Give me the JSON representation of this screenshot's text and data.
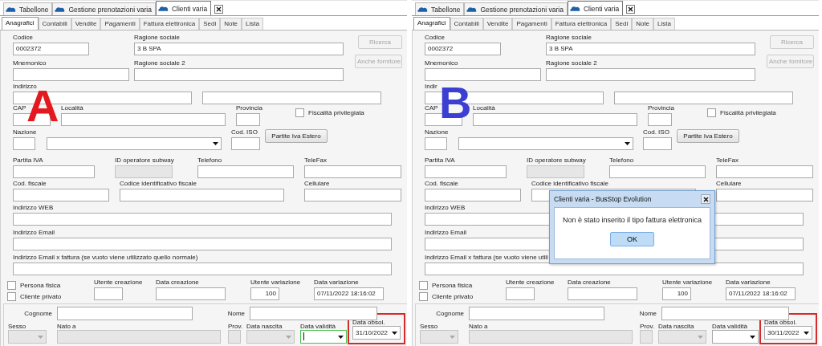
{
  "panels": [
    {
      "marker": {
        "text": "A",
        "color": "#e3191f"
      },
      "doc_tabs": [
        {
          "label": "Tabellone",
          "selected": false
        },
        {
          "label": "Gestione prenotazioni varia",
          "selected": false
        },
        {
          "label": "Clienti varia",
          "selected": true
        }
      ],
      "sub_tabs": [
        {
          "label": "Anagrafici",
          "selected": true
        },
        {
          "label": "Contabili",
          "selected": false
        },
        {
          "label": "Vendite",
          "selected": false
        },
        {
          "label": "Pagamenti",
          "selected": false
        },
        {
          "label": "Fattura elettronica",
          "selected": false
        },
        {
          "label": "Sedi",
          "selected": false
        },
        {
          "label": "Note",
          "selected": false
        },
        {
          "label": "Lista",
          "selected": false
        }
      ],
      "rows": [
        {
          "items": [
            {
              "kind": "text",
              "label": "Codice",
              "value": "0002372",
              "disabled": false
            },
            {
              "kind": "text",
              "label": "Ragione sociale",
              "value": "3 B SPA",
              "disabled": false
            },
            {
              "kind": "button",
              "label": "Ricerca",
              "disabled": true
            }
          ]
        },
        {
          "items": [
            {
              "kind": "text",
              "label": "Mnemonico",
              "disabled": false
            },
            {
              "kind": "text",
              "label": "Ragione sociale 2",
              "disabled": false
            },
            {
              "kind": "button",
              "label": "Anche fornitore",
              "disabled": true
            }
          ]
        },
        {
          "items": [
            {
              "kind": "text",
              "label": "Indirizzo",
              "disabled": false
            },
            {
              "kind": "text",
              "disabled": false
            }
          ]
        },
        {
          "items": [
            {
              "kind": "text",
              "label": "CAP",
              "disabled": false
            },
            {
              "kind": "text",
              "label": "Località",
              "disabled": false
            },
            {
              "kind": "text",
              "label": "Provincia",
              "disabled": false
            },
            {
              "kind": "checkbox",
              "label": "Fiscalità privilegiata",
              "checked": false
            }
          ]
        },
        {
          "items": [
            {
              "kind": "text",
              "label": "Nazione",
              "disabled": false
            },
            {
              "kind": "combo",
              "disabled": false,
              "focused": false
            },
            {
              "kind": "text",
              "label": "Cod. ISO",
              "disabled": false
            },
            {
              "kind": "button",
              "label": "Partite Iva Estero",
              "disabled": false
            }
          ]
        },
        {
          "items": [
            {
              "kind": "text",
              "label": "Partita IVA",
              "disabled": false
            },
            {
              "kind": "text",
              "label": "ID operatore subway",
              "disabled": true
            },
            {
              "kind": "text",
              "label": "Telefono",
              "disabled": false
            },
            {
              "kind": "text",
              "label": "TeleFax",
              "disabled": false
            }
          ]
        },
        {
          "items": [
            {
              "kind": "text",
              "label": "Cod. fiscale",
              "disabled": false
            },
            {
              "kind": "text",
              "label": "Codice identificativo fiscale",
              "disabled": false
            },
            {
              "kind": "text",
              "label": "Cellulare",
              "disabled": false
            }
          ]
        },
        {
          "items": [
            {
              "kind": "text",
              "label": "Indirizzo WEB",
              "disabled": false
            }
          ]
        },
        {
          "items": [
            {
              "kind": "text",
              "label": "Indirizzo Email",
              "disabled": false
            }
          ]
        },
        {
          "items": [
            {
              "kind": "text",
              "label": "Indirizzo Email x fattura (se vuoto viene utilizzato quello normale)",
              "disabled": false
            }
          ]
        },
        {
          "items": [
            {
              "kind": "checkbox-list",
              "items": [
                {
                  "label": "Persona fisica",
                  "checked": false
                },
                {
                  "label": "Cliente privato",
                  "checked": false
                }
              ]
            },
            {
              "kind": "text",
              "label": "Utente creazione",
              "disabled": false
            },
            {
              "kind": "text",
              "label": "Data creazione",
              "disabled": false
            },
            {
              "kind": "number",
              "label": "Utente variazione",
              "value": "100",
              "disabled": false
            },
            {
              "kind": "text",
              "label": "Data variazione",
              "value": "07/11/2022 18:16:02",
              "disabled": false
            }
          ]
        }
      ],
      "person_group": {
        "rows": [
          {
            "items": [
              {
                "kind": "inline",
                "label": "Cognome",
                "disabled": false
              },
              {
                "kind": "inline",
                "label": "Nome",
                "disabled": false
              }
            ]
          },
          {
            "items": [
              {
                "kind": "combo",
                "label": "Sesso",
                "disabled": true,
                "focused": false,
                "highlighted": false
              },
              {
                "kind": "text",
                "label": "Nato a",
                "disabled": true,
                "highlighted": false
              },
              {
                "kind": "text",
                "label": "Prov.",
                "disabled": true,
                "highlighted": false
              },
              {
                "kind": "combo",
                "label": "Data nascita",
                "disabled": true,
                "focused": false,
                "highlighted": false
              },
              {
                "kind": "combo",
                "label": "Data validità",
                "disabled": false,
                "focused": true,
                "highlighted": false
              },
              {
                "kind": "combo",
                "label": "Data obsol.",
                "value": "31/10/2022",
                "disabled": false,
                "focused": false,
                "highlighted": true
              }
            ]
          }
        ]
      }
    },
    {
      "marker": {
        "text": "B",
        "color": "#3b3fd2"
      },
      "doc_tabs": [
        {
          "label": "Tabellone",
          "selected": false
        },
        {
          "label": "Gestione prenotazioni varia",
          "selected": false
        },
        {
          "label": "Clienti varia",
          "selected": true
        }
      ],
      "sub_tabs": [
        {
          "label": "Anagrafici",
          "selected": true
        },
        {
          "label": "Contabili",
          "selected": false
        },
        {
          "label": "Vendite",
          "selected": false
        },
        {
          "label": "Pagamenti",
          "selected": false
        },
        {
          "label": "Fattura elettronica",
          "selected": false
        },
        {
          "label": "Sedi",
          "selected": false
        },
        {
          "label": "Note",
          "selected": false
        },
        {
          "label": "Lista",
          "selected": false
        }
      ],
      "rows": [
        {
          "items": [
            {
              "kind": "text",
              "label": "Codice",
              "value": "0002372",
              "disabled": false
            },
            {
              "kind": "text",
              "label": "Ragione sociale",
              "value": "3 B SPA",
              "disabled": false
            },
            {
              "kind": "button",
              "label": "Ricerca",
              "disabled": true
            }
          ]
        },
        {
          "items": [
            {
              "kind": "text",
              "label": "Mnemonico",
              "disabled": false
            },
            {
              "kind": "text",
              "label": "Ragione sociale 2",
              "disabled": false
            },
            {
              "kind": "button",
              "label": "Anche fornitore",
              "disabled": true
            }
          ]
        },
        {
          "items": [
            {
              "kind": "text",
              "label": "Indir",
              "disabled": false
            },
            {
              "kind": "text",
              "disabled": false
            }
          ]
        },
        {
          "items": [
            {
              "kind": "text",
              "label": "CAP",
              "disabled": false
            },
            {
              "kind": "text",
              "label": "Località",
              "disabled": false
            },
            {
              "kind": "text",
              "label": "Provincia",
              "disabled": false
            },
            {
              "kind": "checkbox",
              "label": "Fiscalità privilegiata",
              "checked": false
            }
          ]
        },
        {
          "items": [
            {
              "kind": "text",
              "label": "Nazione",
              "disabled": false
            },
            {
              "kind": "combo",
              "disabled": false,
              "focused": false
            },
            {
              "kind": "text",
              "label": "Cod. ISO",
              "disabled": false
            },
            {
              "kind": "button",
              "label": "Partite Iva Estero",
              "disabled": false
            }
          ]
        },
        {
          "items": [
            {
              "kind": "text",
              "label": "Partita IVA",
              "disabled": false
            },
            {
              "kind": "text",
              "label": "ID operatore subway",
              "disabled": true
            },
            {
              "kind": "text",
              "label": "Telefono",
              "disabled": false
            },
            {
              "kind": "text",
              "label": "TeleFax",
              "disabled": false
            }
          ]
        },
        {
          "items": [
            {
              "kind": "text",
              "label": "Cod. fiscale",
              "disabled": false
            },
            {
              "kind": "text",
              "label": "Codice identificativo fiscale",
              "disabled": false
            },
            {
              "kind": "text",
              "label": "Cellulare",
              "disabled": false
            }
          ]
        },
        {
          "items": [
            {
              "kind": "text",
              "label": "Indirizzo WEB",
              "disabled": false
            }
          ]
        },
        {
          "items": [
            {
              "kind": "text",
              "label": "Indirizzo Email",
              "disabled": false
            }
          ]
        },
        {
          "items": [
            {
              "kind": "text",
              "label": "Indirizzo Email x fattura (se vuoto viene utili",
              "disabled": false
            }
          ]
        },
        {
          "items": [
            {
              "kind": "checkbox-list",
              "items": [
                {
                  "label": "Persona fisica",
                  "checked": false
                },
                {
                  "label": "Cliente privato",
                  "checked": false
                }
              ]
            },
            {
              "kind": "text",
              "label": "Utente creazione",
              "disabled": false
            },
            {
              "kind": "text",
              "label": "Data creazione",
              "disabled": false
            },
            {
              "kind": "number",
              "label": "Utente variazione",
              "value": "100",
              "disabled": false
            },
            {
              "kind": "text",
              "label": "Data variazione",
              "value": "07/11/2022 18:16:02",
              "disabled": false
            }
          ]
        }
      ],
      "person_group": {
        "rows": [
          {
            "items": [
              {
                "kind": "inline",
                "label": "Cognome",
                "disabled": false
              },
              {
                "kind": "inline",
                "label": "Nome",
                "disabled": false
              }
            ]
          },
          {
            "items": [
              {
                "kind": "combo",
                "label": "Sesso",
                "disabled": true,
                "focused": false,
                "highlighted": false
              },
              {
                "kind": "text",
                "label": "Nato a",
                "disabled": true,
                "highlighted": false
              },
              {
                "kind": "text",
                "label": "Prov.",
                "disabled": true,
                "highlighted": false
              },
              {
                "kind": "combo",
                "label": "Data nascita",
                "disabled": true,
                "focused": false,
                "highlighted": false
              },
              {
                "kind": "combo",
                "label": "Data validità",
                "disabled": false,
                "focused": false,
                "highlighted": false
              },
              {
                "kind": "combo",
                "label": "Data obsol.",
                "value": "30/11/2022",
                "disabled": false,
                "focused": false,
                "highlighted": true
              }
            ]
          }
        ]
      },
      "dialog": {
        "title": "Clienti varia - BusStop Evolution",
        "message": "Non è stato inserito il tipo fattura elettronica",
        "button": "OK"
      }
    }
  ]
}
